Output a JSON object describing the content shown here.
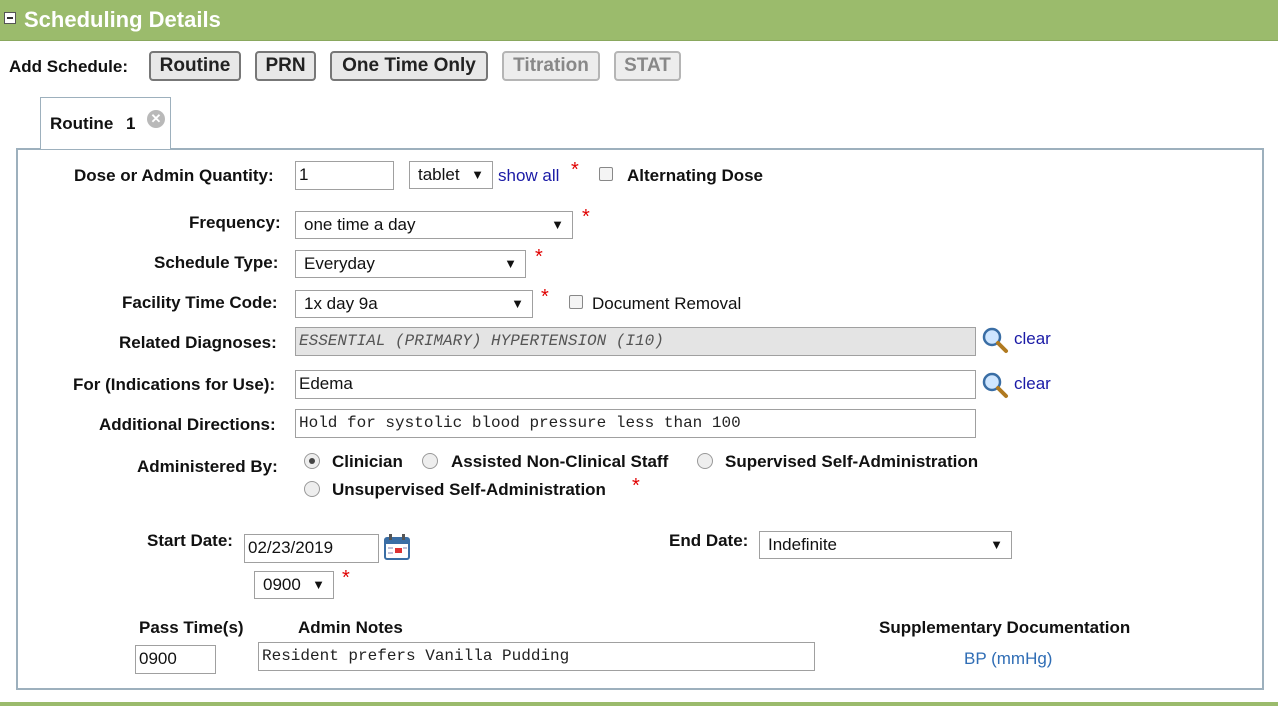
{
  "header": {
    "title": "Scheduling Details"
  },
  "add_schedule": {
    "label": "Add Schedule:",
    "buttons": [
      "Routine",
      "PRN",
      "One Time Only",
      "Titration",
      "STAT"
    ]
  },
  "tab": {
    "label": "Routine",
    "number": "1"
  },
  "form": {
    "dose_label": "Dose or Admin Quantity:",
    "dose_value": "1",
    "unit_value": "tablet",
    "show_all": "show all",
    "required_mark": "*",
    "alternating_dose": "Alternating Dose",
    "frequency_label": "Frequency:",
    "frequency_value": "one time a day",
    "schedule_type_label": "Schedule Type:",
    "schedule_type_value": "Everyday",
    "facility_time_label": "Facility Time Code:",
    "facility_time_value": "1x day 9a",
    "document_removal": "Document Removal",
    "related_diagnoses_label": "Related Diagnoses:",
    "related_diagnoses_value": "ESSENTIAL (PRIMARY) HYPERTENSION (I10)",
    "clear": "clear",
    "indications_label": "For (Indications for Use):",
    "indications_value": "Edema",
    "additional_directions_label": "Additional Directions:",
    "additional_directions_value": "Hold for systolic blood pressure less than 100",
    "administered_by_label": "Administered By:",
    "administered_options": [
      "Clinician",
      "Assisted Non-Clinical Staff",
      "Supervised Self-Administration",
      "Unsupervised Self-Administration"
    ],
    "administered_selected": "Clinician",
    "start_date_label": "Start Date:",
    "start_date_value": "02/23/2019",
    "start_time_value": "0900",
    "end_date_label": "End Date:",
    "end_date_value": "Indefinite",
    "pass_times_label": "Pass Time(s)",
    "pass_time_value": "0900",
    "admin_notes_label": "Admin Notes",
    "admin_notes_value": "Resident prefers Vanilla Pudding",
    "supplementary_label": "Supplementary Documentation",
    "supplementary_link": "BP (mmHg)"
  },
  "colors": {
    "header_green": "#9bbb6c",
    "required_red": "#e00000",
    "link_blue": "#1a1aa6",
    "panel_border": "#9db0bd"
  }
}
